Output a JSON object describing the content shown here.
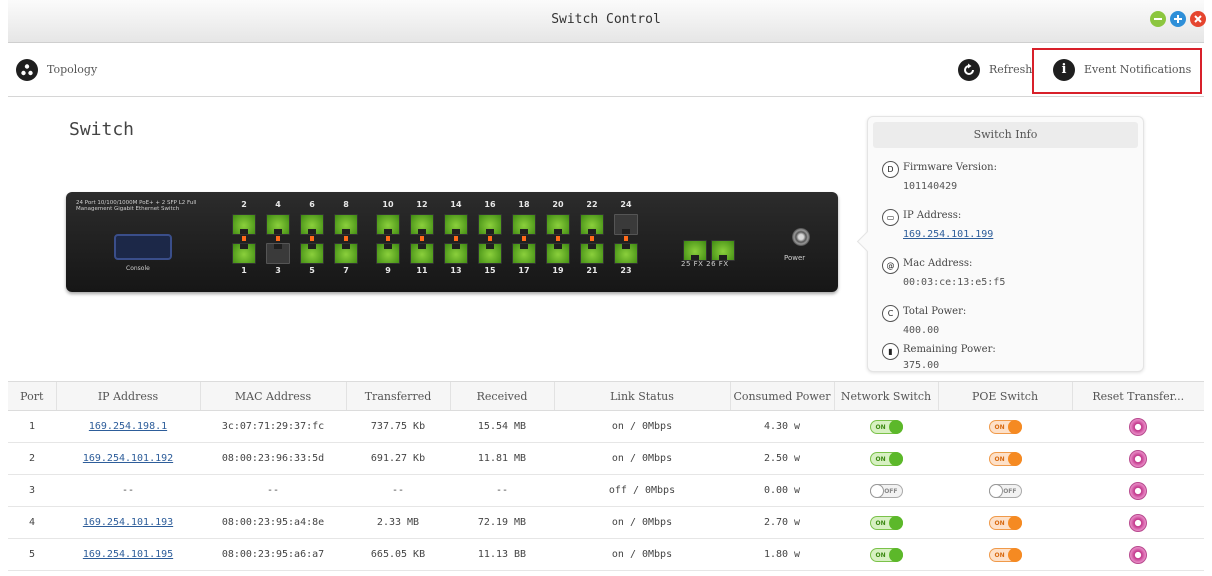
{
  "window": {
    "title": "Switch Control",
    "controls": [
      {
        "name": "minimize",
        "color": "#8cc63f",
        "icon": "minus-icon"
      },
      {
        "name": "maximize",
        "color": "#2e8fd8",
        "icon": "plus-icon"
      },
      {
        "name": "close",
        "color": "#e5452f",
        "icon": "x-icon"
      }
    ]
  },
  "toolbar": {
    "topology_label": "Topology",
    "refresh_label": "Refresh",
    "events_label": "Event Notifications",
    "highlight_color": "#d8202a"
  },
  "switch": {
    "heading": "Switch",
    "description": "24 Port 10/100/1000M PoE+ + 2 SFP L2 Full Management Gigabit Ethernet Switch",
    "console_label": "Console",
    "power_label": "Power",
    "sfp_label": "25 FX 26 FX",
    "port_up_color": "#6cbf2a",
    "ports_top": [
      {
        "num": "2",
        "up": true
      },
      {
        "num": "4",
        "up": true
      },
      {
        "num": "6",
        "up": true
      },
      {
        "num": "8",
        "up": true
      },
      {
        "num": "10",
        "up": true
      },
      {
        "num": "12",
        "up": true
      },
      {
        "num": "14",
        "up": true
      },
      {
        "num": "16",
        "up": true
      },
      {
        "num": "18",
        "up": true
      },
      {
        "num": "20",
        "up": true
      },
      {
        "num": "22",
        "up": true
      },
      {
        "num": "24",
        "up": false
      }
    ],
    "ports_bottom": [
      {
        "num": "1",
        "up": true
      },
      {
        "num": "3",
        "up": false
      },
      {
        "num": "5",
        "up": true
      },
      {
        "num": "7",
        "up": true
      },
      {
        "num": "9",
        "up": true
      },
      {
        "num": "11",
        "up": true
      },
      {
        "num": "13",
        "up": true
      },
      {
        "num": "15",
        "up": true
      },
      {
        "num": "17",
        "up": true
      },
      {
        "num": "19",
        "up": true
      },
      {
        "num": "21",
        "up": true
      },
      {
        "num": "23",
        "up": true
      }
    ]
  },
  "switch_info": {
    "header": "Switch Info",
    "firmware_label": "Firmware Version:",
    "firmware_value": "101140429",
    "ip_label": "IP Address:",
    "ip_value": "169.254.101.199",
    "mac_label": "Mac Address:",
    "mac_value": "00:03:ce:13:e5:f5",
    "total_power_label": "Total Power:",
    "total_power_value": "400.00",
    "remaining_power_label": "Remaining Power:",
    "remaining_power_value": "375.00"
  },
  "table": {
    "columns": [
      "Port",
      "IP Address",
      "MAC Address",
      "Transferred",
      "Received",
      "Link Status",
      "Consumed Power",
      "Network Switch",
      "POE Switch",
      "Reset Transfer..."
    ],
    "rows": [
      {
        "port": "1",
        "ip": "169.254.198.1",
        "mac": "3c:07:71:29:37:fc",
        "transferred": "737.75 Kb",
        "received": "15.54 MB",
        "link": "on / 0Mbps",
        "power": "4.30 w",
        "net": true,
        "poe": true
      },
      {
        "port": "2",
        "ip": "169.254.101.192",
        "mac": "08:00:23:96:33:5d",
        "transferred": "691.27 Kb",
        "received": "11.81 MB",
        "link": "on / 0Mbps",
        "power": "2.50 w",
        "net": true,
        "poe": true
      },
      {
        "port": "3",
        "ip": "--",
        "mac": "--",
        "transferred": "--",
        "received": "--",
        "link": "off / 0Mbps",
        "power": "0.00 w",
        "net": false,
        "poe": false
      },
      {
        "port": "4",
        "ip": "169.254.101.193",
        "mac": "08:00:23:95:a4:8e",
        "transferred": "2.33 MB",
        "received": "72.19 MB",
        "link": "on / 0Mbps",
        "power": "2.70 w",
        "net": true,
        "poe": true
      },
      {
        "port": "5",
        "ip": "169.254.101.195",
        "mac": "08:00:23:95:a6:a7",
        "transferred": "665.05 KB",
        "received": "11.13 BB",
        "link": "on / 0Mbps",
        "power": "1.80 w",
        "net": true,
        "poe": true
      }
    ],
    "toggle_on_text": "ON",
    "toggle_off_text": "OFF"
  }
}
